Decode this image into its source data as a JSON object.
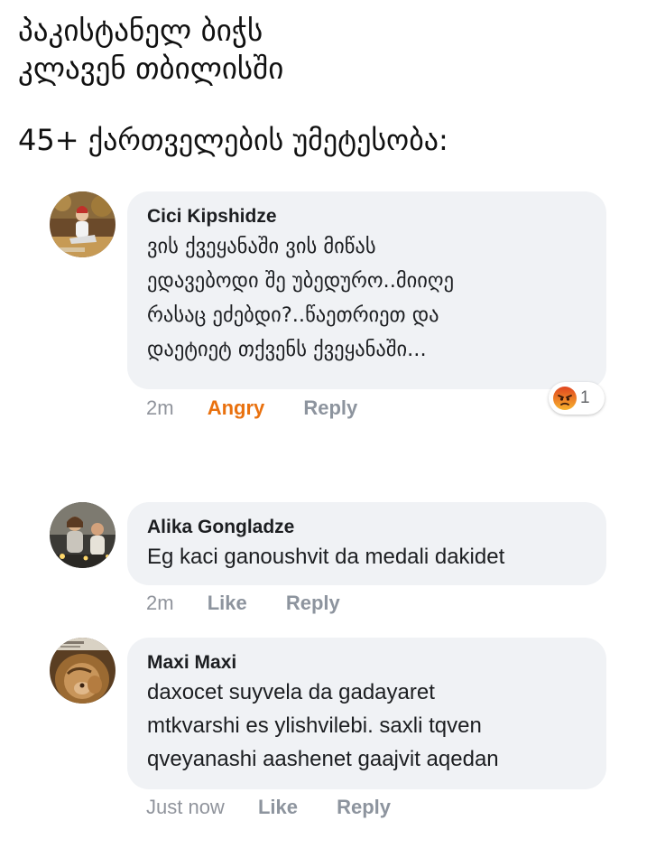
{
  "header": {
    "title_line_1": "პაკისტანელ ბიჭს",
    "title_line_2": "კლავენ თბილისში",
    "subtitle": "45+ ქართველების უმეტესობა:"
  },
  "comments": [
    {
      "author": "Cici Kipshidze",
      "text_lines": [
        "ვის ქვეყანაში ვის მიწას",
        "ედავებოდი შე უბედურო..მიიღე",
        "რასაც ეძებდი?..წაეთრიეთ და",
        "დაეტიეტ თქვენს ქვეყანაში..."
      ],
      "time": "2m",
      "reaction_label": "Angry",
      "reply_label": "Reply",
      "reaction_count": "1",
      "reaction_icon": "angry-emoji-icon"
    },
    {
      "author": "Alika Gongladze",
      "text_lines": [
        "Eg kaci ganoushvit da medali dakidet"
      ],
      "time": "2m",
      "like_label": "Like",
      "reply_label": "Reply"
    },
    {
      "author": "Maxi Maxi",
      "text_lines": [
        "daxocet suyvela da gadayaret",
        "mtkvarshi es ylishvilebi. saxli tqven",
        "qveyanashi aashenet gaajvit aqedan"
      ],
      "time": "Just now",
      "like_label": "Like",
      "reply_label": "Reply"
    }
  ],
  "colors": {
    "bubble": "#f0f2f5",
    "meta_text": "#90949c",
    "angry": "#e9710f"
  }
}
